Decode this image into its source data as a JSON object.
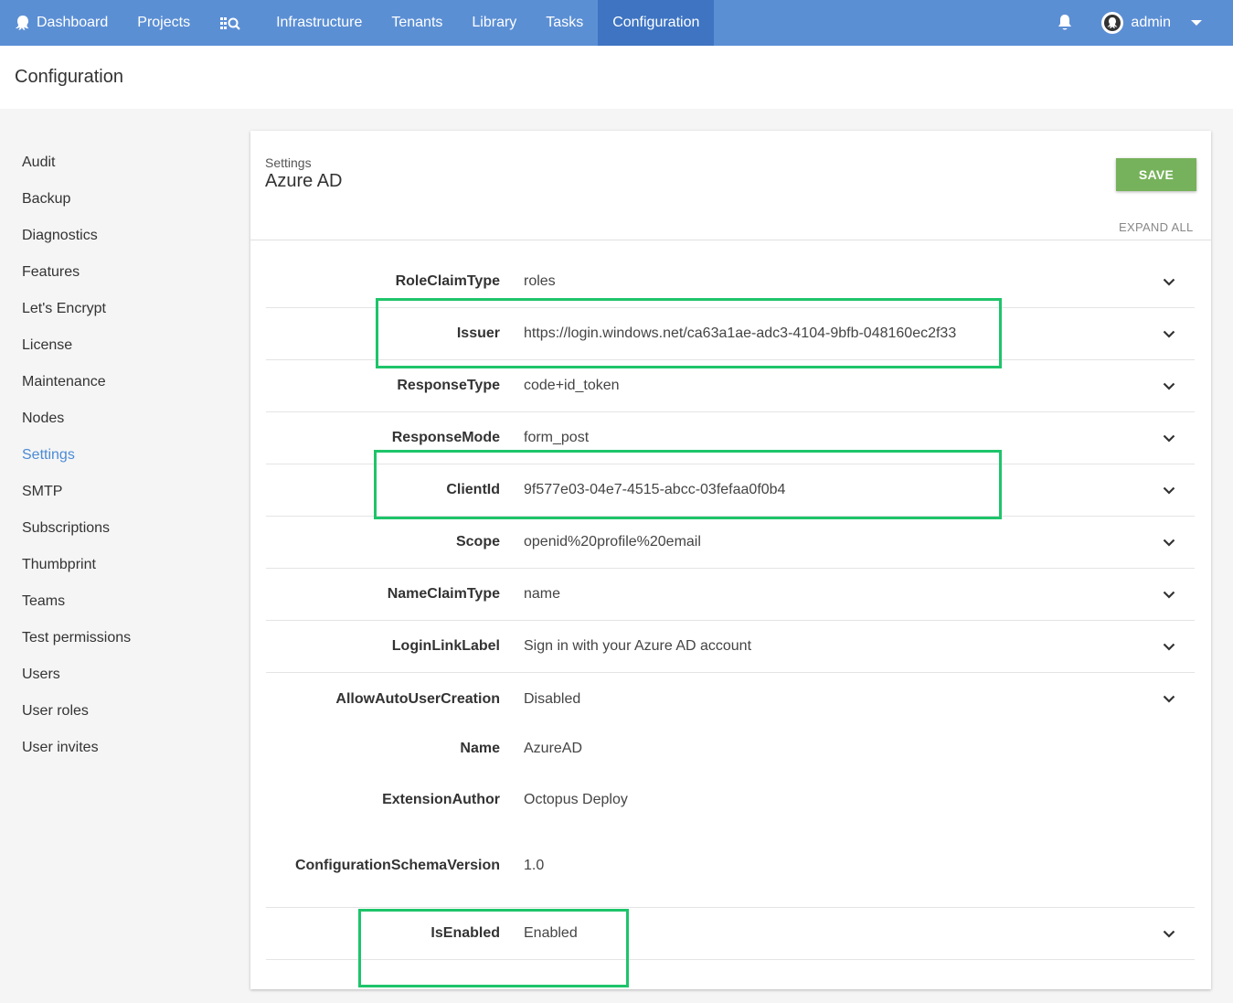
{
  "nav": {
    "items": [
      {
        "label": "Dashboard",
        "icon": "octopus-icon",
        "active": false
      },
      {
        "label": "Projects",
        "icon": "",
        "active": false
      },
      {
        "label": "",
        "icon": "search-library-icon",
        "active": false
      },
      {
        "label": "Infrastructure",
        "icon": "",
        "active": false
      },
      {
        "label": "Tenants",
        "icon": "",
        "active": false
      },
      {
        "label": "Library",
        "icon": "",
        "active": false
      },
      {
        "label": "Tasks",
        "icon": "",
        "active": false
      },
      {
        "label": "Configuration",
        "icon": "",
        "active": true
      }
    ],
    "user_name": "admin",
    "colors": {
      "bar": "#5b8fd4",
      "active": "#3e74c2"
    }
  },
  "page": {
    "title": "Configuration"
  },
  "sidebar": {
    "items": [
      {
        "label": "Audit"
      },
      {
        "label": "Backup"
      },
      {
        "label": "Diagnostics"
      },
      {
        "label": "Features"
      },
      {
        "label": "Let's Encrypt"
      },
      {
        "label": "License"
      },
      {
        "label": "Maintenance"
      },
      {
        "label": "Nodes"
      },
      {
        "label": "Settings",
        "active": true
      },
      {
        "label": "SMTP"
      },
      {
        "label": "Subscriptions"
      },
      {
        "label": "Thumbprint"
      },
      {
        "label": "Teams"
      },
      {
        "label": "Test permissions"
      },
      {
        "label": "Users"
      },
      {
        "label": "User roles"
      },
      {
        "label": "User invites"
      }
    ]
  },
  "card": {
    "subtitle": "Settings",
    "title": "Azure AD",
    "save_label": "SAVE",
    "expand_all_label": "EXPAND ALL",
    "save_color": "#76b25b"
  },
  "settings": {
    "expandable": [
      {
        "label": "RoleClaimType",
        "value": "roles"
      },
      {
        "label": "Issuer",
        "value": "https://login.windows.net/ca63a1ae-adc3-4104-9bfb-048160ec2f33"
      },
      {
        "label": "ResponseType",
        "value": "code+id_token"
      },
      {
        "label": "ResponseMode",
        "value": "form_post"
      },
      {
        "label": "ClientId",
        "value": "9f577e03-04e7-4515-abcc-03fefaa0f0b4"
      },
      {
        "label": "Scope",
        "value": "openid%20profile%20email"
      },
      {
        "label": "NameClaimType",
        "value": "name"
      },
      {
        "label": "LoginLinkLabel",
        "value": "Sign in with your Azure AD account"
      },
      {
        "label": "AllowAutoUserCreation",
        "value": "Disabled"
      }
    ],
    "readonly": [
      {
        "label": "Name",
        "value": "AzureAD"
      },
      {
        "label": "ExtensionAuthor",
        "value": "Octopus Deploy"
      },
      {
        "label": "ConfigurationSchemaVersion",
        "value": "1.0"
      }
    ],
    "is_enabled": {
      "label": "IsEnabled",
      "value": "Enabled"
    }
  },
  "highlight_color": "#1ec46a"
}
